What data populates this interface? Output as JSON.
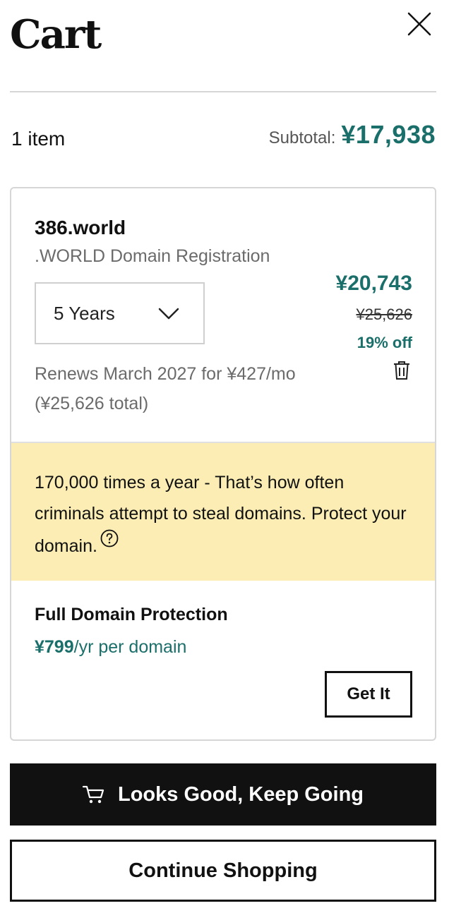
{
  "header": {
    "title": "Cart",
    "close_icon": "close-icon"
  },
  "summary": {
    "item_count": "1 item",
    "subtotal_label": "Subtotal:",
    "subtotal_value": "¥17,938"
  },
  "cart_item": {
    "domain_name": "386.world",
    "product_type": ".WORLD Domain Registration",
    "term_selected": "5 Years",
    "price_current": "¥20,743",
    "price_original": "¥25,626",
    "discount": "19% off",
    "renewal_text": "Renews March 2027 for ¥427/mo (¥25,626 total)",
    "trash_icon": "trash-icon"
  },
  "promo": {
    "message": "170,000 times a year - That’s how often criminals attempt to steal domains. Protect your domain.",
    "help_icon": "question-circle-icon"
  },
  "upsell": {
    "title": "Full Domain Protection",
    "price": "¥799",
    "price_suffix": "/yr per domain",
    "button_label": "Get It"
  },
  "actions": {
    "primary_label": "Looks Good, Keep Going",
    "primary_icon": "cart-icon",
    "secondary_label": "Continue Shopping"
  },
  "colors": {
    "accent": "#1b6f6a",
    "promo_bg": "#fbedb4",
    "primary_button_bg": "#111111"
  }
}
